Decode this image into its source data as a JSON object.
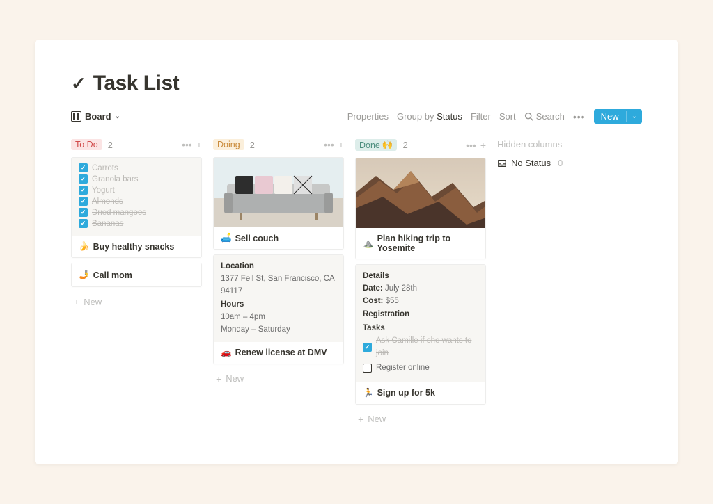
{
  "page": {
    "icon": "✓",
    "title": "Task List"
  },
  "toolbar": {
    "view_label": "Board",
    "properties": "Properties",
    "group_by_prefix": "Group by ",
    "group_by_value": "Status",
    "filter": "Filter",
    "sort": "Sort",
    "search": "Search",
    "new_label": "New"
  },
  "columns": [
    {
      "name": "To Do",
      "style": "todo",
      "count": 2,
      "cards": [
        {
          "type": "checklist",
          "emoji": "🍌",
          "title": "Buy healthy snacks",
          "items": [
            {
              "label": "Carrots",
              "checked": true
            },
            {
              "label": "Granola bars",
              "checked": true
            },
            {
              "label": "Yogurt",
              "checked": true
            },
            {
              "label": "Almonds",
              "checked": true
            },
            {
              "label": "Dried mangoes",
              "checked": true
            },
            {
              "label": "Bananas",
              "checked": true
            }
          ]
        },
        {
          "type": "simple",
          "emoji": "🤳",
          "title": "Call mom"
        }
      ],
      "new_label": "New"
    },
    {
      "name": "Doing",
      "style": "doing",
      "count": 2,
      "cards": [
        {
          "type": "image",
          "image": "couch",
          "emoji": "🛋️",
          "title": "Sell couch"
        },
        {
          "type": "detail",
          "emoji": "🚗",
          "title": "Renew license at DMV",
          "sections": [
            {
              "label": "Location",
              "text": "1377 Fell St, San Francisco, CA 94117"
            },
            {
              "label": "Hours",
              "text": "10am – 4pm\nMonday – Saturday"
            }
          ]
        }
      ],
      "new_label": "New"
    },
    {
      "name": "Done",
      "style": "done",
      "emoji": "🙌",
      "count": 2,
      "cards": [
        {
          "type": "image",
          "image": "mountain",
          "emoji": "⛰️",
          "title": "Plan hiking trip to Yosemite"
        },
        {
          "type": "detail-tasks",
          "emoji": "🏃",
          "title": "Sign up for 5k",
          "header": "Details",
          "lines": [
            {
              "key": "Date:",
              "val": "July 28th"
            },
            {
              "key": "Cost:",
              "val": "$55"
            }
          ],
          "sub1": "Registration",
          "sub2": "Tasks",
          "tasks": [
            {
              "label": "Ask Camille if she wants to join",
              "checked": true
            },
            {
              "label": "Register online",
              "checked": false
            }
          ]
        }
      ],
      "new_label": "New"
    }
  ],
  "hidden": {
    "header": "Hidden columns",
    "no_status": "No Status",
    "no_status_count": 0
  }
}
